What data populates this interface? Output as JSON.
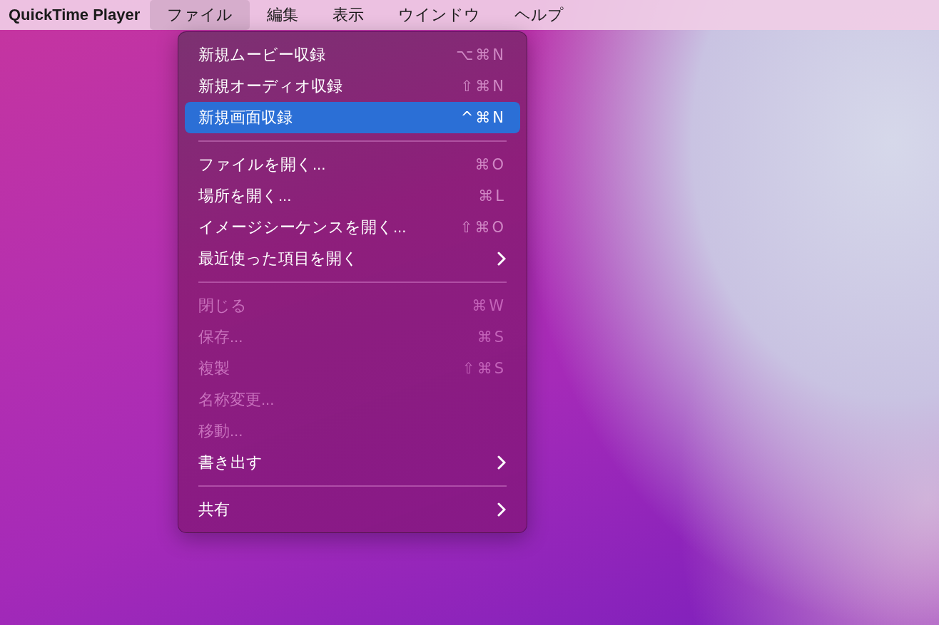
{
  "menu_bar": {
    "app_name": "QuickTime Player",
    "items": [
      {
        "label": "ファイル",
        "selected": true
      },
      {
        "label": "編集",
        "selected": false
      },
      {
        "label": "表示",
        "selected": false
      },
      {
        "label": "ウインドウ",
        "selected": false
      },
      {
        "label": "ヘルプ",
        "selected": false
      }
    ]
  },
  "file_menu": {
    "items": [
      {
        "kind": "item",
        "label": "新規ムービー収録",
        "shortcut": "⌥⌘N",
        "disabled": false,
        "selected": false,
        "submenu": false
      },
      {
        "kind": "item",
        "label": "新規オーディオ収録",
        "shortcut": "⇧⌘N",
        "disabled": false,
        "selected": false,
        "submenu": false
      },
      {
        "kind": "item",
        "label": "新規画面収録",
        "shortcut": "^⌘N",
        "disabled": false,
        "selected": true,
        "submenu": false
      },
      {
        "kind": "separator"
      },
      {
        "kind": "item",
        "label": "ファイルを開く...",
        "shortcut": "⌘O",
        "disabled": false,
        "selected": false,
        "submenu": false
      },
      {
        "kind": "item",
        "label": "場所を開く...",
        "shortcut": "⌘L",
        "disabled": false,
        "selected": false,
        "submenu": false
      },
      {
        "kind": "item",
        "label": "イメージシーケンスを開く...",
        "shortcut": "⇧⌘O",
        "disabled": false,
        "selected": false,
        "submenu": false
      },
      {
        "kind": "item",
        "label": "最近使った項目を開く",
        "disabled": false,
        "selected": false,
        "submenu": true
      },
      {
        "kind": "separator"
      },
      {
        "kind": "item",
        "label": "閉じる",
        "shortcut": "⌘W",
        "disabled": true,
        "selected": false,
        "submenu": false
      },
      {
        "kind": "item",
        "label": "保存...",
        "shortcut": "⌘S",
        "disabled": true,
        "selected": false,
        "submenu": false
      },
      {
        "kind": "item",
        "label": "複製",
        "shortcut": "⇧⌘S",
        "disabled": true,
        "selected": false,
        "submenu": false
      },
      {
        "kind": "item",
        "label": "名称変更...",
        "disabled": true,
        "selected": false,
        "submenu": false
      },
      {
        "kind": "item",
        "label": "移動...",
        "disabled": true,
        "selected": false,
        "submenu": false
      },
      {
        "kind": "item",
        "label": "書き出す",
        "disabled": false,
        "selected": false,
        "submenu": true
      },
      {
        "kind": "separator"
      },
      {
        "kind": "item",
        "label": "共有",
        "disabled": false,
        "selected": false,
        "submenu": true
      }
    ]
  }
}
